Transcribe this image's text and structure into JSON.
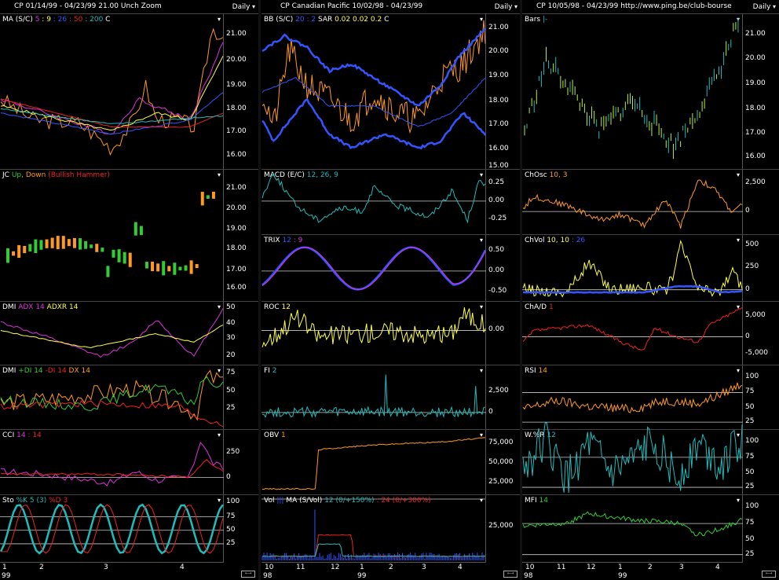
{
  "colors": {
    "bg": "#000000",
    "grid": "#ffffff",
    "yellow": "#ffff44",
    "orange": "#ff9922",
    "cyan": "#22bbbb",
    "blue": "#3355ff",
    "red": "#ee2222",
    "magenta": "#dd33dd",
    "green": "#33cc33",
    "greenyellow": "#bbee33"
  },
  "columns": [
    {
      "header": "CP   01/14/99 - 04/23/99   21.00  Unch   Zoom",
      "period": "Daily",
      "panels": [
        {
          "label": "MA (S/C)",
          "params": [
            {
              "t": " 5",
              "c": "#dd33dd"
            },
            {
              "t": " : 9",
              "c": "#ffff44"
            },
            {
              "t": " : 26",
              "c": "#3355ff"
            },
            {
              "t": " : 50",
              "c": "#ee2222"
            },
            {
              "t": " : 200",
              "c": "#22bbbb"
            },
            {
              "t": "   C",
              "c": "#ffffff"
            }
          ],
          "ticks": [
            "21.00",
            "20.00",
            "19.00",
            "18.00",
            "17.00",
            "16.00"
          ]
        },
        {
          "label": "JC",
          "params": [
            {
              "t": " Up",
              "c": "#33cc33"
            },
            {
              "t": ", Down",
              "c": "#ff9922"
            },
            {
              "t": " (Bullish Hammer)",
              "c": "#ee2222"
            }
          ],
          "ticks": [
            "21.00",
            "20.00",
            "19.00",
            "18.00",
            "17.00",
            "16.00"
          ]
        },
        {
          "label": "DMI",
          "params": [
            {
              "t": " ADX 14",
              "c": "#dd33dd"
            },
            {
              "t": "  ADXR 14",
              "c": "#ffff44"
            }
          ],
          "ticks": [
            "50",
            "40",
            "30",
            "20"
          ]
        },
        {
          "label": "DMI",
          "params": [
            {
              "t": " +DI 14",
              "c": "#33cc33"
            },
            {
              "t": "  -DI 14",
              "c": "#ee2222"
            },
            {
              "t": "  DX 14",
              "c": "#ff9922"
            }
          ],
          "ticks": [
            "75",
            "50",
            "25"
          ]
        },
        {
          "label": "CCI",
          "params": [
            {
              "t": "  14",
              "c": "#dd33dd"
            },
            {
              "t": " : 14",
              "c": "#ee2222"
            }
          ],
          "ticks": [
            "250",
            "0"
          ]
        },
        {
          "label": "Sto",
          "params": [
            {
              "t": "  %K 5 (3)",
              "c": "#22bbbb"
            },
            {
              "t": "  %D 3",
              "c": "#ee2222"
            }
          ],
          "ticks": [
            "100",
            "75",
            "50",
            "25"
          ]
        }
      ],
      "xaxis": {
        "labels": [
          "1",
          "2",
          "3",
          "4"
        ],
        "year": "99"
      }
    },
    {
      "header": "CP   Canadian Pacific  10/02/98 - 04/23/99",
      "period": "Daily",
      "panels": [
        {
          "label": "BB (S/C)",
          "params": [
            {
              "t": " 20",
              "c": "#3355ff"
            },
            {
              "t": " : 2",
              "c": "#3355ff"
            },
            {
              "t": "    SAR",
              "c": "#ffffff"
            },
            {
              "t": "  0.02  0.02  0.2",
              "c": "#ffff44"
            },
            {
              "t": "    C",
              "c": "#ffffff"
            }
          ],
          "ticks": [
            "21.00",
            "20.00",
            "19.00",
            "18.00",
            "17.00",
            "16.00",
            "15.00"
          ]
        },
        {
          "label": "MACD (E/C)",
          "params": [
            {
              "t": " 12, 26, 9",
              "c": "#22bbbb"
            }
          ],
          "ticks": [
            "0.25",
            "0.00",
            "-0.25"
          ]
        },
        {
          "label": "TRIX",
          "params": [
            {
              "t": "  12",
              "c": "#3355ff"
            },
            {
              "t": " : 9",
              "c": "#dd33dd"
            }
          ],
          "ticks": [
            "0.50",
            "0.00",
            "-0.50"
          ]
        },
        {
          "label": "ROC",
          "params": [
            {
              "t": "  12",
              "c": "#ffff44"
            }
          ],
          "ticks": [
            "0.00"
          ]
        },
        {
          "label": "FI",
          "params": [
            {
              "t": "  2",
              "c": "#22bbbb"
            }
          ],
          "ticks": [
            "2,500",
            "0"
          ]
        },
        {
          "label": "OBV",
          "params": [
            {
              "t": "  1",
              "c": "#ff9922"
            }
          ],
          "ticks": [
            "75,000",
            "50,000",
            "25,000"
          ]
        },
        {
          "label": "Vol",
          "params": [
            {
              "t": "  |||",
              "c": "#3355ff"
            },
            {
              "t": "   MA (S/Vol)",
              "c": "#ffffff"
            },
            {
              "t": "  12 (0/+150%)",
              "c": "#22bbbb"
            },
            {
              "t": " : 24 (0/+300%)",
              "c": "#ee2222"
            }
          ],
          "ticks": [
            "25,000"
          ]
        }
      ],
      "xaxis": {
        "labels": [
          "10",
          "11",
          "12",
          "1",
          "2",
          "3",
          "4"
        ],
        "year": "98",
        "year2": "99"
      }
    },
    {
      "header": "CP   10/05/98 - 04/23/99     http://www.ping.be/club-bourse",
      "period": "Daily",
      "panels": [
        {
          "label": "Bars",
          "params": [
            {
              "t": "  |-",
              "c": "#22bbbb"
            }
          ],
          "ticks": [
            "21.00",
            "20.00",
            "19.00",
            "18.00",
            "17.00",
            "16.00"
          ]
        },
        {
          "label": "ChOsc",
          "params": [
            {
              "t": "  10, 3",
              "c": "#ff9922"
            }
          ],
          "ticks": [
            "2,500",
            "0"
          ]
        },
        {
          "label": "ChVol",
          "params": [
            {
              "t": "  10, 10",
              "c": "#ffff44"
            },
            {
              "t": " : 26",
              "c": "#3355ff"
            }
          ],
          "ticks": [
            "500",
            "250",
            "0"
          ]
        },
        {
          "label": "ChA/D",
          "params": [
            {
              "t": "  1",
              "c": "#ee2222"
            }
          ],
          "ticks": [
            "5,000",
            "0",
            "-5,000"
          ]
        },
        {
          "label": "RSI",
          "params": [
            {
              "t": "  14",
              "c": "#ff9922"
            }
          ],
          "ticks": [
            "100",
            "75",
            "50",
            "25"
          ]
        },
        {
          "label": "W.%R",
          "params": [
            {
              "t": "  12",
              "c": "#22bbbb"
            }
          ],
          "ticks": [
            "100",
            "75",
            "50",
            "25"
          ]
        },
        {
          "label": "MFI",
          "params": [
            {
              "t": "  14",
              "c": "#33cc33"
            }
          ],
          "ticks": [
            "100",
            "75",
            "50",
            "25"
          ]
        }
      ],
      "xaxis": {
        "labels": [
          "10",
          "11",
          "12",
          "1",
          "2",
          "3",
          "4"
        ],
        "year": "98",
        "year2": "99"
      }
    }
  ]
}
